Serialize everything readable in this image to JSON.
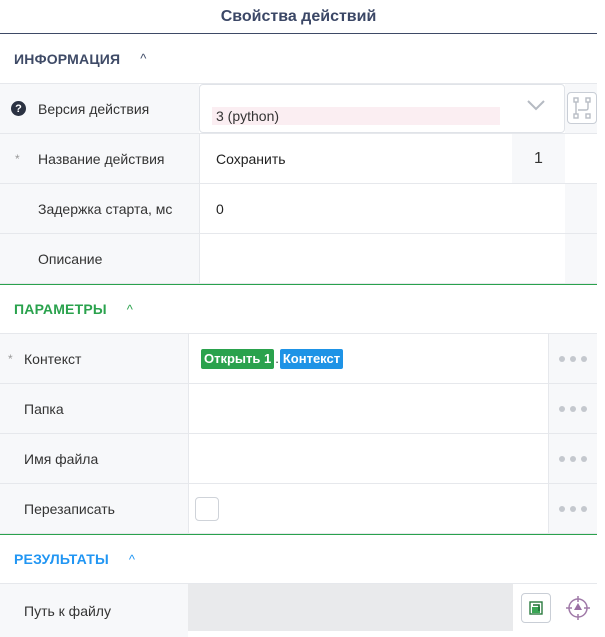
{
  "header": {
    "title": "Свойства действий"
  },
  "sections": {
    "info": {
      "title": "ИНФОРМАЦИЯ",
      "color": "#3e4a66"
    },
    "params": {
      "title": "ПАРАМЕТРЫ",
      "color": "#2aa24d"
    },
    "results": {
      "title": "РЕЗУЛЬТАТЫ",
      "color": "#2196f3"
    }
  },
  "info": {
    "version": {
      "label": "Версия действия",
      "value": "3 (python)"
    },
    "name": {
      "label": "Название действия",
      "value": "Сохранить",
      "counter": "1"
    },
    "delay": {
      "label": "Задержка старта, мс",
      "value": "0"
    },
    "description": {
      "label": "Описание",
      "value": ""
    }
  },
  "params": {
    "context": {
      "label": "Контекст",
      "tag_action": "Открыть 1",
      "separator": ".",
      "tag_field": "Контекст"
    },
    "folder": {
      "label": "Папка",
      "value": ""
    },
    "filename": {
      "label": "Имя файла",
      "value": ""
    },
    "overwrite": {
      "label": "Перезаписать",
      "checked": false
    }
  },
  "results": {
    "filepath": {
      "label": "Путь к файлу",
      "value": ""
    }
  },
  "icons": {
    "help": "question-circle-icon",
    "chevron_up": "chevron-up-icon",
    "chevron_down": "chevron-down-icon",
    "flow": "flow-diagram-icon",
    "more": "more-dots-icon",
    "result_action": "green-arrow-icon",
    "target": "crosshair-icon"
  },
  "symbols": {
    "required": "*",
    "help": "?",
    "chevron_up": "^"
  }
}
